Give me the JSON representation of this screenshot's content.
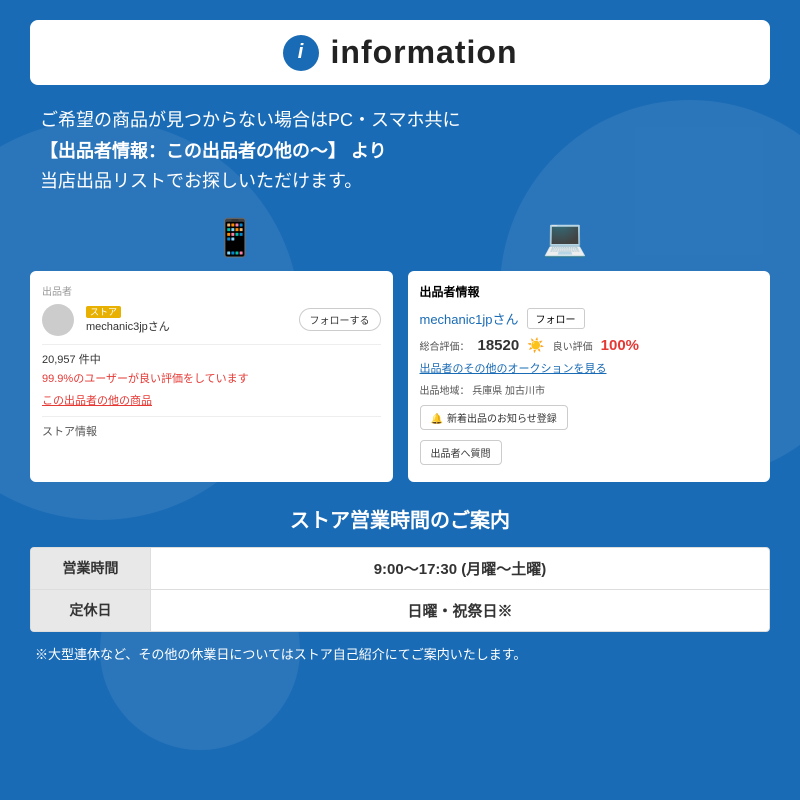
{
  "background_color": "#1a6bb5",
  "header": {
    "title": "information",
    "icon_label": "i"
  },
  "description": {
    "line1": "ご希望の商品が見つからない場合はPC・スマホ共に",
    "line2": "【出品者情報：この出品者の他の〜】 より",
    "line3": "当店出品リストでお探しいただけます。"
  },
  "screenshot_left": {
    "section_label": "出品者",
    "store_badge": "ストア",
    "username": "mechanic3jpさん",
    "follow_btn": "フォローする",
    "count": "20,957 件中",
    "rating": "99.9%のユーザーが良い評価をしています",
    "other_link": "この出品者の他の商品",
    "store_info": "ストア情報"
  },
  "screenshot_right": {
    "title": "出品者情報",
    "username": "mechanic1jpさん",
    "follow_btn": "フォロー",
    "rating_label": "総合評価：",
    "rating_num": "18520",
    "good_label": "良い評価",
    "good_pct": "100%",
    "auction_link": "出品者のその他のオークションを見る",
    "location_label": "出品地域：",
    "location": "兵庫県 加古川市",
    "new_items_btn": "新着出品のお知らせ登録",
    "question_btn": "出品者へ質問"
  },
  "store_hours": {
    "title": "ストア営業時間のご案内",
    "rows": [
      {
        "label": "営業時間",
        "value": "9:00〜17:30 (月曜〜土曜)"
      },
      {
        "label": "定休日",
        "value": "日曜・祝祭日※"
      }
    ],
    "note": "※大型連休など、その他の休業日についてはストア自己紹介にてご案内いたします。"
  }
}
